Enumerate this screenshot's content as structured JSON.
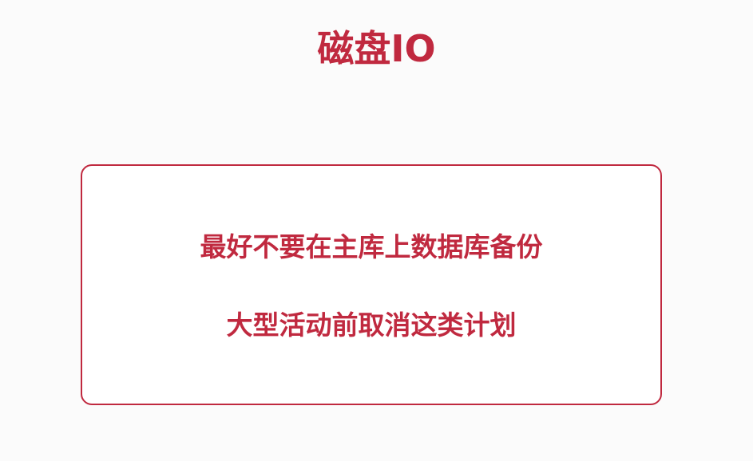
{
  "slide": {
    "title": "磁盘IO",
    "box_lines": [
      "最好不要在主库上数据库备份",
      "大型活动前取消这类计划"
    ]
  },
  "colors": {
    "accent": "#c0293f",
    "background": "#fbfbfb",
    "box_background": "#ffffff"
  }
}
